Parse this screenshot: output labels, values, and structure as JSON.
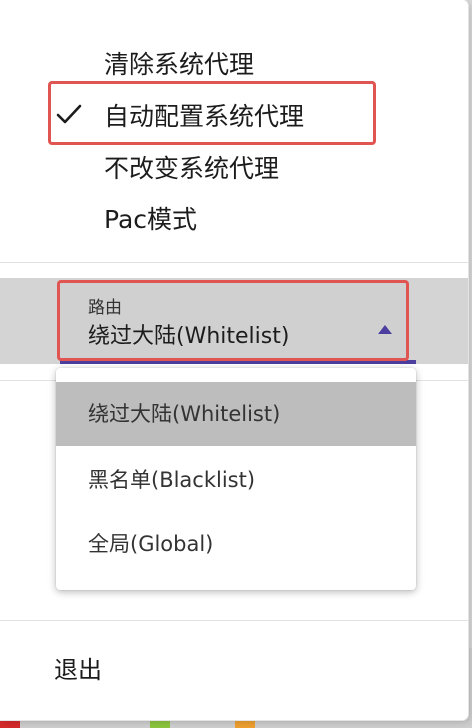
{
  "proxy_modes": {
    "items": [
      {
        "label": "清除系统代理",
        "checked": false
      },
      {
        "label": "自动配置系统代理",
        "checked": true
      },
      {
        "label": "不改变系统代理",
        "checked": false
      },
      {
        "label": "Pac模式",
        "checked": false
      }
    ]
  },
  "routing": {
    "label": "路由",
    "value": "绕过大陆(Whitelist)",
    "options": [
      {
        "label": "绕过大陆(Whitelist)",
        "selected": true
      },
      {
        "label": "黑名单(Blacklist)",
        "selected": false
      },
      {
        "label": "全局(Global)",
        "selected": false
      }
    ]
  },
  "menu": {
    "exit_label": "退出"
  },
  "colors": {
    "highlight": "#e05452",
    "accent": "#4b3e9e",
    "selected_option_bg": "#bdbdbd"
  }
}
